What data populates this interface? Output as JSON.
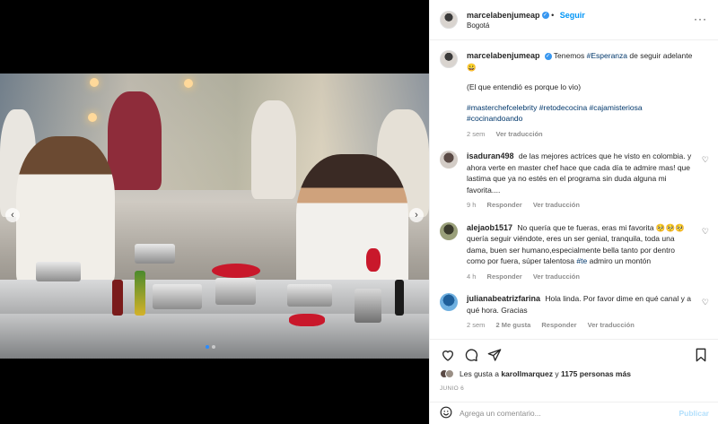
{
  "header": {
    "username": "marcelabenjumeap",
    "follow_label": "Seguir",
    "location": "Bogotá"
  },
  "caption": {
    "username": "marcelabenjumeap",
    "text_before_tag": "Tenemos",
    "tag": "#Esperanza",
    "text_after_tag": "de seguir adelante 😀",
    "line2": "(El que entendió es porque lo vio)",
    "hashtags": "#masterchefcelebrity #retodecocina #cajamisteriosa #cocinandoando",
    "time": "2 sem",
    "translate_label": "Ver traducción"
  },
  "comments": [
    {
      "username": "isaduran498",
      "text": "de las mejores actrices que he visto en colombia. y ahora verte en master chef hace que cada día te admire mas! que lastima que ya no estés en el programa sin duda alguna mi favorita....",
      "time": "9 h",
      "reply_label": "Responder",
      "translate_label": "Ver traducción"
    },
    {
      "username": "alejaob1517",
      "text_before_tag": "No quería que te fueras, eras mi favorita 🥺🥺🥺 quería seguir viéndote, eres un ser genial, tranquila, toda una dama, buen ser humano,especialmente bella tanto por dentro como por fuera, súper talentosa",
      "tag": "#te",
      "text_after_tag": "admiro un montón",
      "time": "4 h",
      "reply_label": "Responder",
      "translate_label": "Ver traducción"
    },
    {
      "username": "julianabeatrizfarina",
      "text": "Hola linda. Por favor dime en qué canal y a qué hora. Gracias",
      "time": "2 sem",
      "likes": "2 Me gusta",
      "reply_label": "Responder",
      "translate_label": "Ver traducción"
    }
  ],
  "likes": {
    "prefix": "Les gusta a",
    "user": "karollmarquez",
    "middle": "y",
    "count": "1175 personas más"
  },
  "date": "JUNIO 6",
  "add_comment": {
    "placeholder": "Agrega un comentario...",
    "publish_label": "Publicar"
  },
  "carousel": {
    "prev_symbol": "‹",
    "next_symbol": "›"
  },
  "colors": {
    "link": "#00376b",
    "follow": "#0095f6",
    "verified": "#3897f0",
    "muted": "#8e8e8e"
  }
}
